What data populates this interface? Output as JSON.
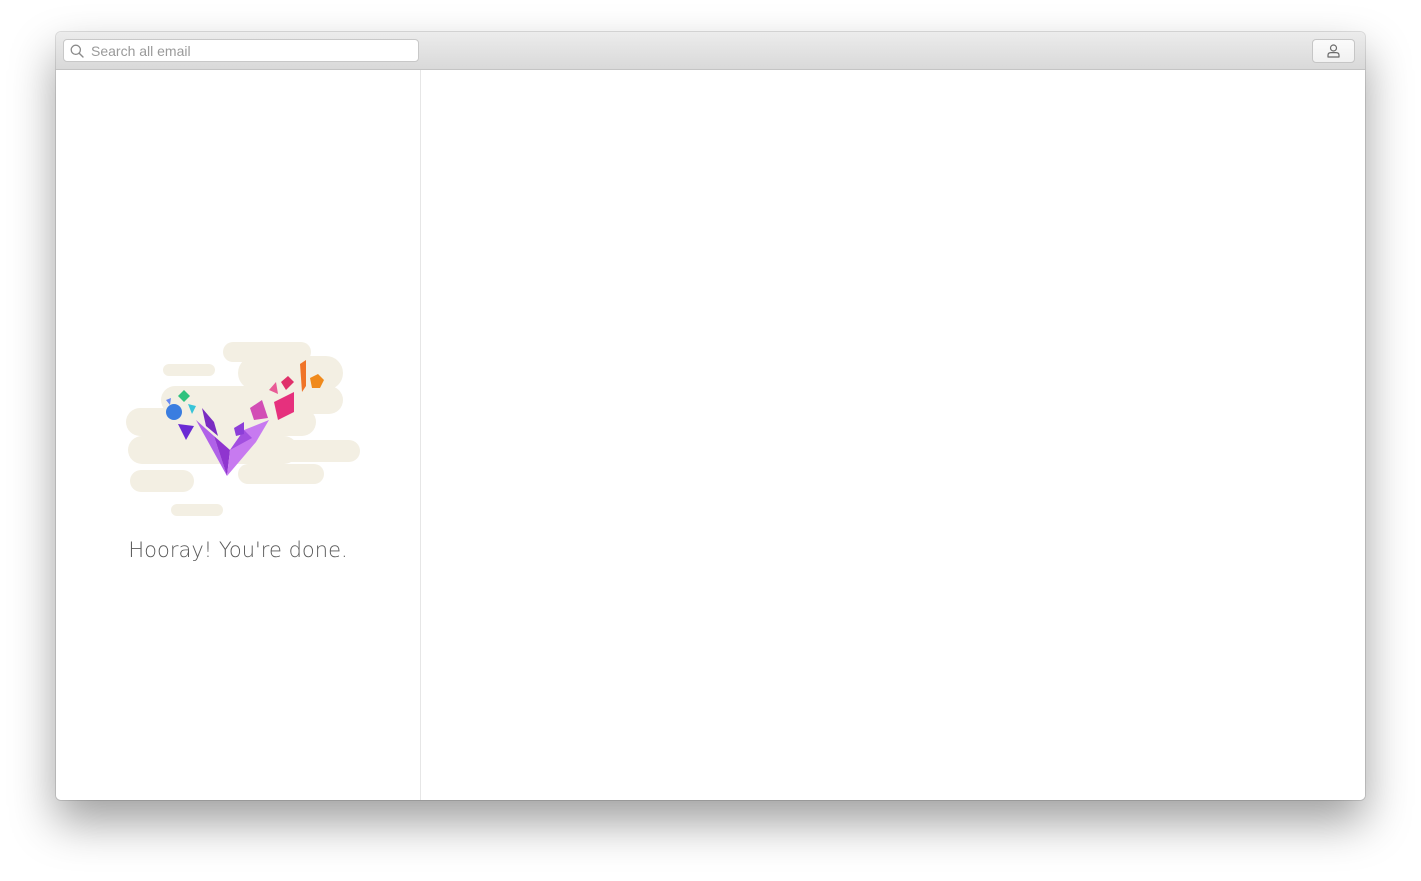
{
  "search": {
    "placeholder": "Search all email",
    "value": "",
    "icon": "search-icon"
  },
  "header": {
    "account_icon": "user-icon"
  },
  "inbox": {
    "empty_message": "Hooray! You're done.",
    "illustration": "gem-checkmark-illustration"
  },
  "colors": {
    "cloud": "#f3efe3",
    "gem_purple": "#9b3fd9",
    "gem_pink": "#e0307a",
    "gem_blue": "#3a7de0",
    "gem_orange": "#f08a1c"
  }
}
